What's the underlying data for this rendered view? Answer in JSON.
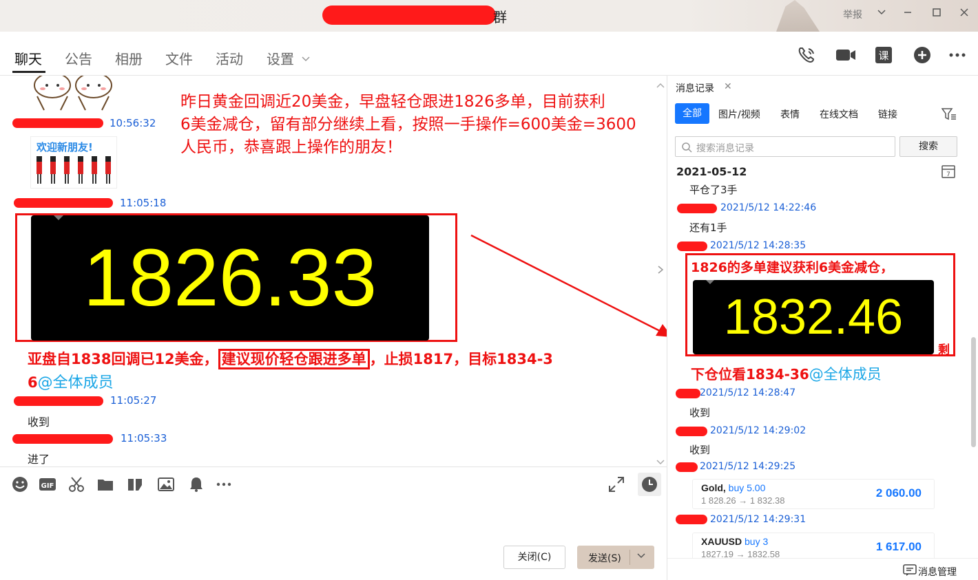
{
  "window": {
    "title_suffix": "群",
    "report": "举报",
    "controls": [
      "minimize",
      "maximize",
      "close"
    ]
  },
  "tabs": [
    {
      "label": "聊天",
      "active": true
    },
    {
      "label": "公告"
    },
    {
      "label": "相册"
    },
    {
      "label": "文件"
    },
    {
      "label": "活动"
    },
    {
      "label": "设置"
    }
  ],
  "tab_icons": [
    "phone-icon",
    "video-icon",
    "class-icon",
    "add-icon",
    "more-icon"
  ],
  "chat": {
    "messages": [
      {
        "time": "10:56:32"
      },
      {
        "time": "11:05:18"
      },
      {
        "time": "11:05:27",
        "text": "收到"
      },
      {
        "time": "11:05:33",
        "text": "进了"
      }
    ],
    "annotation_top": [
      "昨日黄金回调近20美金，早盘轻仓跟进1826多单，目前获利",
      "6美金减仓，留有部分继续上看，按照一手操作=600美金=3600",
      "人民币，恭喜跟上操作的朋友！"
    ],
    "price_main": "1826.33",
    "sticker_text": "欢迎新朋友!",
    "signal_line1_a": "亚盘自1838回调已12美金，",
    "signal_line1_b": "建议现价轻仓跟进多单",
    "signal_line1_c": "，止损1817，目标1834-3",
    "signal_line2_a": "6",
    "signal_line2_b": "@全体成员"
  },
  "composer": {
    "icons": [
      "emoji-icon",
      "gif-icon",
      "scissors-icon",
      "folder-icon",
      "image-edit-icon",
      "picture-icon",
      "bell-icon",
      "more-icon"
    ],
    "close_label": "关闭(C)",
    "send_label": "发送(S)"
  },
  "history": {
    "title": "消息记录",
    "tabs": [
      "全部",
      "图片/视频",
      "表情",
      "在线文档",
      "链接"
    ],
    "search_placeholder": "搜索消息记录",
    "search_button": "搜索",
    "date": "2021-05-12",
    "entries": [
      {
        "text": "平仓了3手"
      },
      {
        "time": "2021/5/12 14:22:46",
        "text": "还有1手"
      },
      {
        "time": "2021/5/12 14:28:35"
      },
      {
        "time": "2021/5/12 14:28:47",
        "text": "收到"
      },
      {
        "time": "2021/5/12 14:29:02",
        "text": "收到"
      },
      {
        "time": "2021/5/12 14:29:25"
      },
      {
        "time": "2021/5/12 14:29:31"
      }
    ],
    "signal_title": "1826的多单建议获利6美金减仓，",
    "price_small": "1832.46",
    "signal_remain": "剩",
    "signal_line2": "下仓位看1834-36",
    "signal_at": "@全体成员",
    "cards": [
      {
        "symbol": "Gold,",
        "action": "buy 5.00",
        "range": "1 828.26 → 1 832.38",
        "value": "2 060.00"
      },
      {
        "symbol": "XAUUSD",
        "action": "buy 3",
        "range": "1827.19 → 1832.58",
        "value": "1 617.00"
      }
    ],
    "footer": "消息管理"
  },
  "colors": {
    "red": "#ee1111",
    "blue_time": "#1a5fd6",
    "accent": "#1677ff",
    "price_yellow": "#ffff00"
  }
}
